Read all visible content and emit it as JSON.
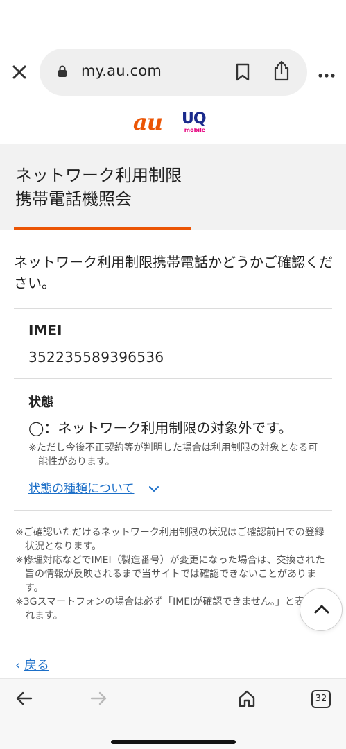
{
  "browser": {
    "url": "my.au.com",
    "tab_count": "32"
  },
  "icons": {
    "close": "close-icon",
    "lock": "lock-icon",
    "bookmark": "bookmark-icon",
    "share": "share-icon",
    "more": "more-icon",
    "chevron": "chevron-down-icon",
    "scroll_top": "chevron-up-icon",
    "back": "arrow-left-icon",
    "forward": "arrow-right-icon",
    "home": "home-icon"
  },
  "brand": {
    "au_logo": "au",
    "uq_logo": "UQ",
    "uq_sub": "mobile"
  },
  "colors": {
    "accent": "#eb5505",
    "link": "#1c6fc8",
    "panel": "#f2f2f2"
  },
  "page": {
    "title_line1": "ネットワーク利用制限",
    "title_line2": "携帯電話機照会",
    "intro": "ネットワーク利用制限携帯電話かどうかご確認ください。",
    "imei_label": "IMEI",
    "imei_value": "352235589396536",
    "status_label": "状態",
    "status_value": "◯：ネットワーク利用制限の対象外です。",
    "status_note": "※ただし今後不正契約等が判明した場合は利用制限の対象となる可能性があります。",
    "types_link": "状態の種類について",
    "notes": [
      "※ご確認いただけるネットワーク利用制限の状況はご確認前日での登録状況となります。",
      "※修理対応などでIMEI（製造番号）が変更になった場合は、交換された旨の情報が反映されるまで当サイトでは確認できないことがあります。",
      "※3Gスマートフォンの場合は必ず「IMEIが確認できません。」と表記されます。"
    ],
    "back_arrow": "‹",
    "back_link": "戻る"
  }
}
